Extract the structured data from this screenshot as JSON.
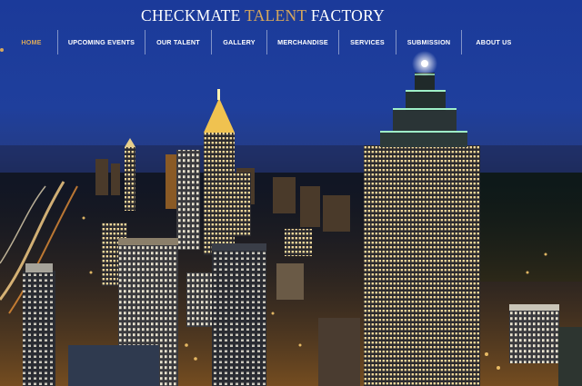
{
  "site": {
    "title_part1": "CHECKMATE",
    "title_accent": "TALENT",
    "title_part2": "FACTORY"
  },
  "nav": {
    "items": [
      {
        "label": "HOME",
        "active": true
      },
      {
        "label": "UPCOMING EVENTS",
        "active": false
      },
      {
        "label": "OUR TALENT",
        "active": false
      },
      {
        "label": "GALLERY",
        "active": false
      },
      {
        "label": "MERCHANDISE",
        "active": false
      },
      {
        "label": "SERVICES",
        "active": false
      },
      {
        "label": "SUBMISSION",
        "active": false
      },
      {
        "label": "ABOUT US",
        "active": false
      }
    ]
  },
  "colors": {
    "accent": "#d6a75c",
    "text": "#ffffff",
    "sky": "#1f3f9c"
  }
}
